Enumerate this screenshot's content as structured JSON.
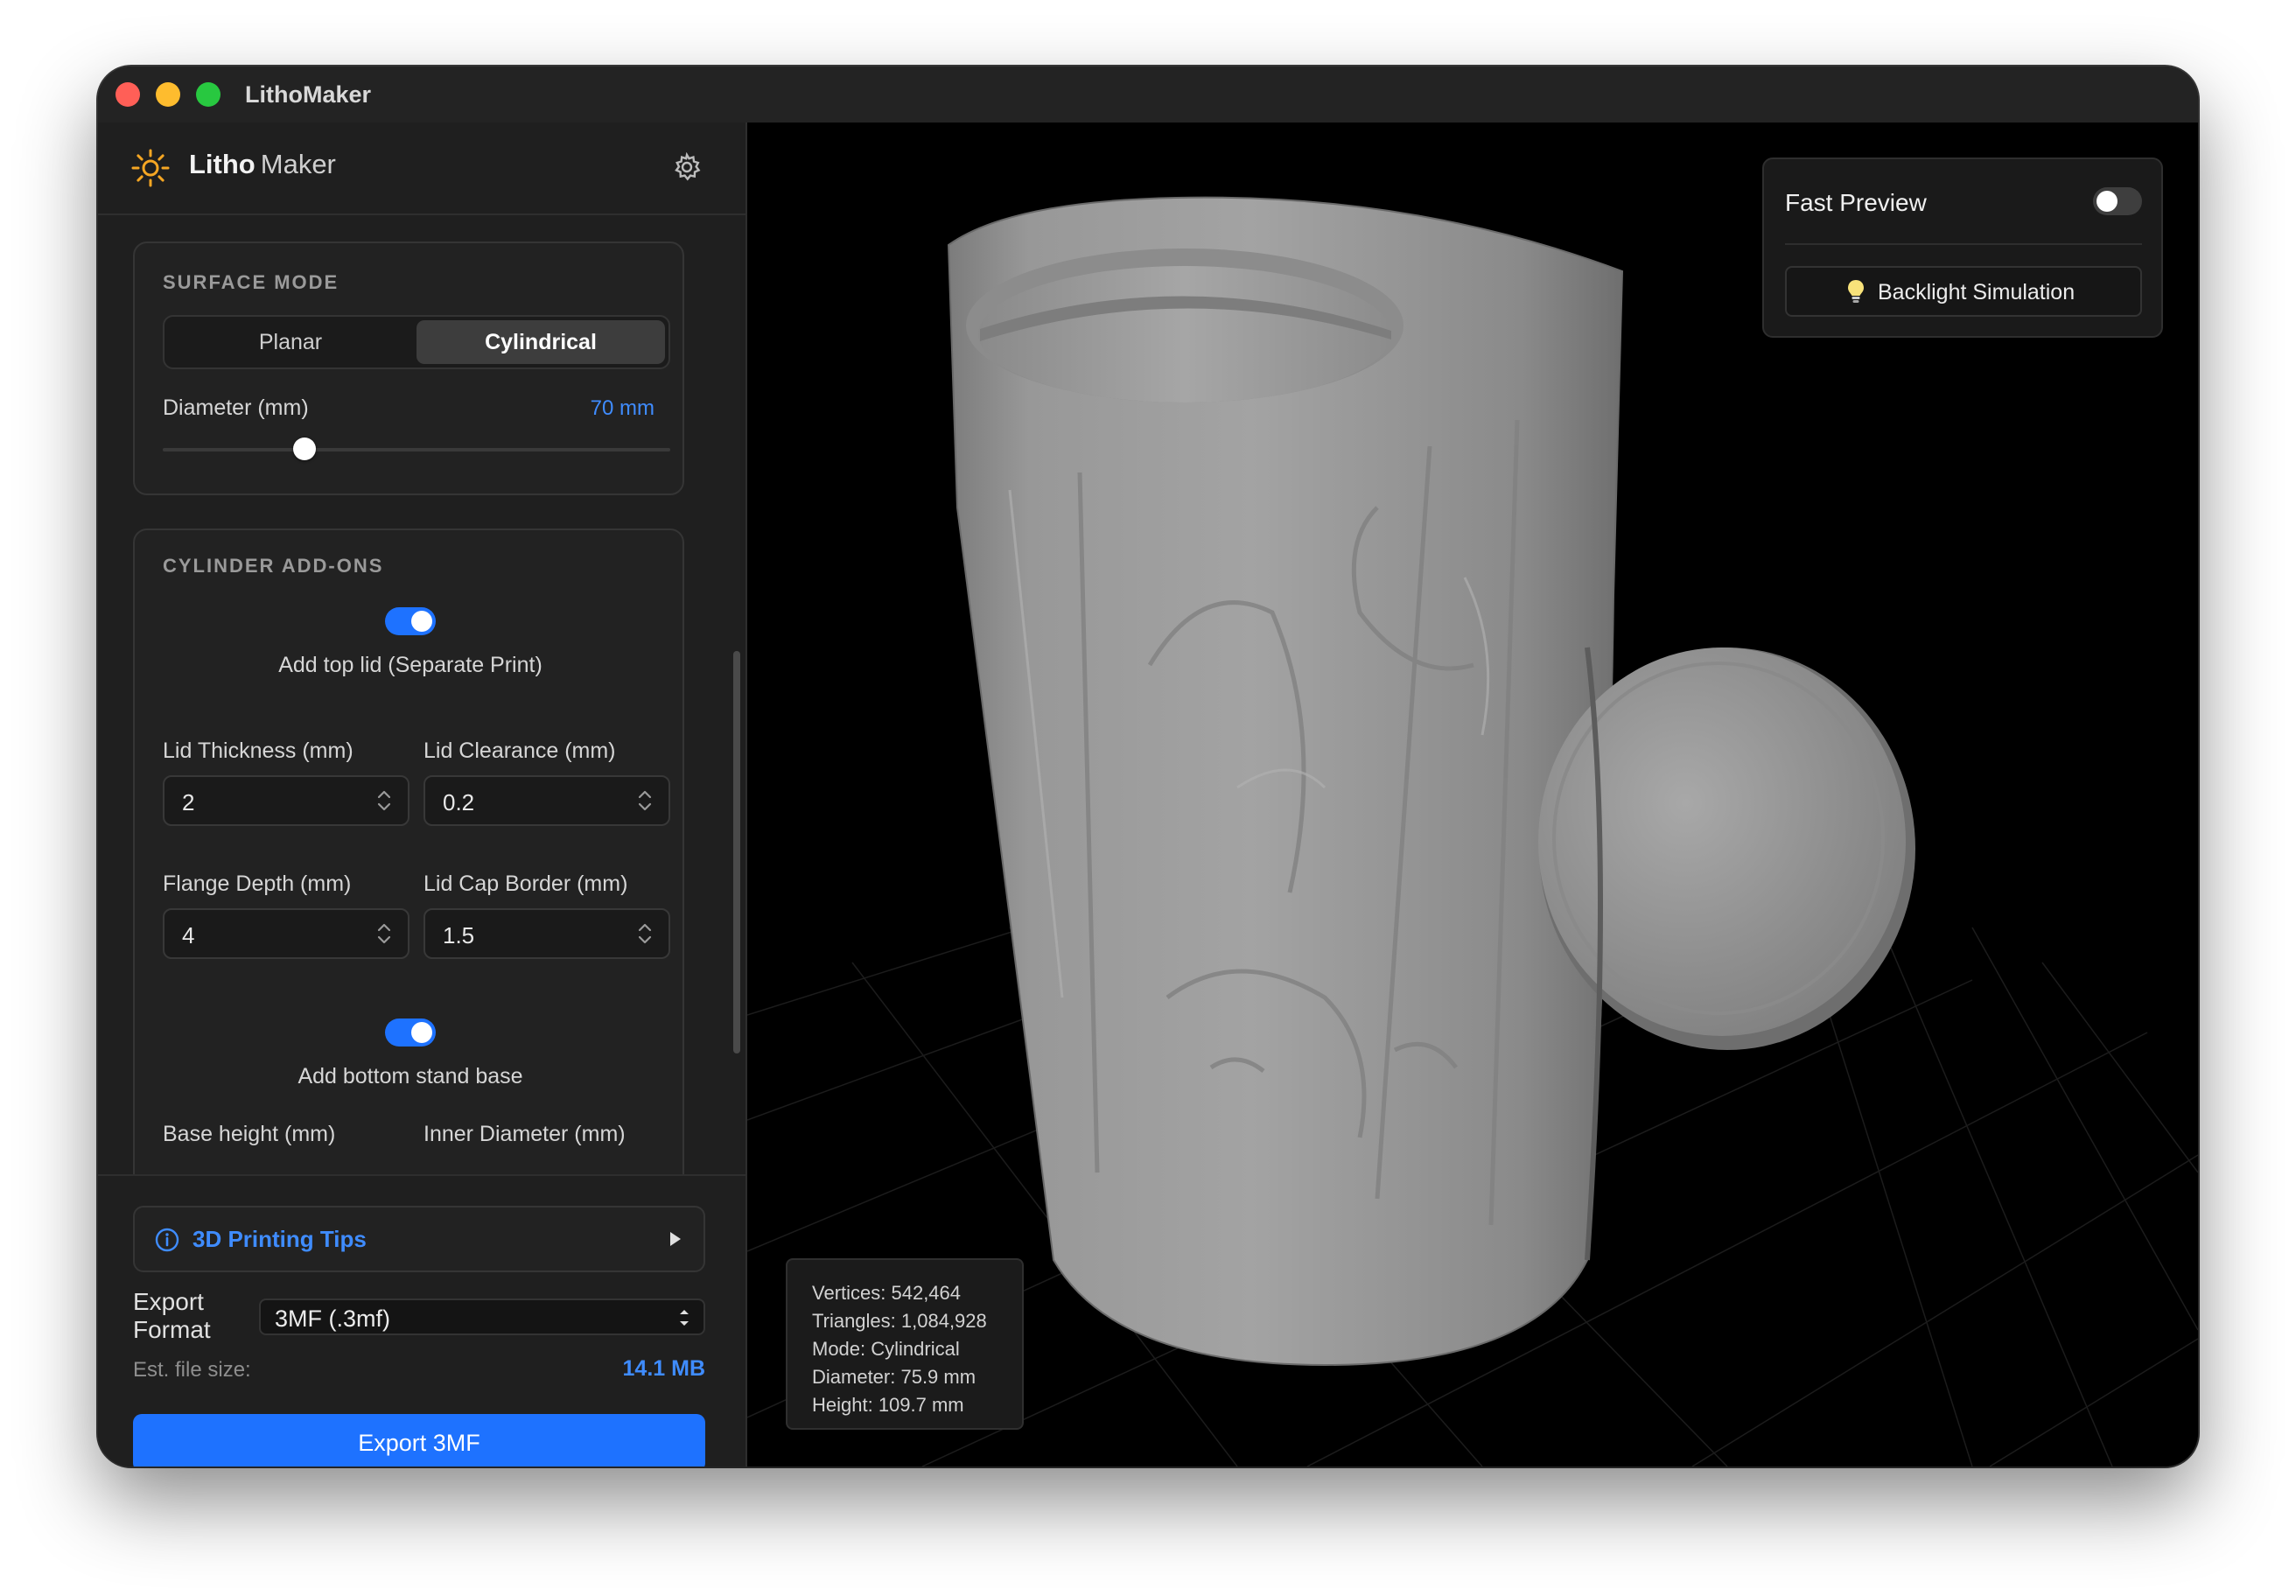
{
  "window": {
    "title": "LithoMaker"
  },
  "app": {
    "logo_bold": "Litho",
    "logo_light": "Maker"
  },
  "surface_mode": {
    "title": "SURFACE MODE",
    "options": [
      "Planar",
      "Cylindrical"
    ],
    "selected": "Cylindrical",
    "diameter_label": "Diameter (mm)",
    "diameter_value": "70 mm",
    "diameter_slider_fraction": 0.28
  },
  "cylinder_addons": {
    "title": "CYLINDER ADD-ONS",
    "top_lid": {
      "label": "Add top lid (Separate Print)",
      "enabled": true
    },
    "lid_thickness": {
      "label": "Lid Thickness (mm)",
      "value": "2"
    },
    "lid_clearance": {
      "label": "Lid Clearance (mm)",
      "value": "0.2"
    },
    "flange_depth": {
      "label": "Flange Depth (mm)",
      "value": "4"
    },
    "lid_cap_border": {
      "label": "Lid Cap Border (mm)",
      "value": "1.5"
    },
    "bottom_base": {
      "label": "Add bottom stand base",
      "enabled": true
    },
    "base_height": {
      "label": "Base height (mm)"
    },
    "inner_diameter": {
      "label": "Inner Diameter (mm)"
    }
  },
  "tips": {
    "label": "3D Printing Tips"
  },
  "export": {
    "format_label": "Export Format",
    "format_value": "3MF (.3mf)",
    "est_label": "Est. file size:",
    "est_value": "14.1 MB",
    "button_label": "Export 3MF"
  },
  "viewport": {
    "fast_preview_label": "Fast Preview",
    "fast_preview_enabled": false,
    "backlight_label": "Backlight Simulation",
    "stats": {
      "vertices": "Vertices: 542,464",
      "triangles": "Triangles: 1,084,928",
      "mode": "Mode: Cylindrical",
      "diameter": "Diameter: 75.9 mm",
      "height": "Height: 109.7 mm"
    }
  },
  "colors": {
    "accent": "#1e72ff",
    "link": "#3f8cff",
    "model": "#8f8f8f"
  },
  "icons": [
    "sun-logo-icon",
    "gear-icon",
    "info-icon",
    "play-icon",
    "lightbulb-icon",
    "updown-chevron-icon"
  ]
}
